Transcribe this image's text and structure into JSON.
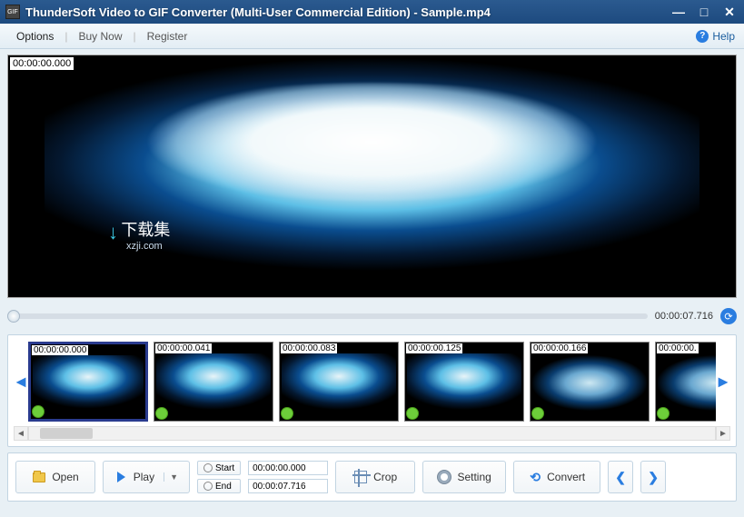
{
  "titlebar": {
    "app_icon_label": "GIF",
    "title": "ThunderSoft Video to GIF Converter (Multi-User Commercial Edition) - Sample.mp4"
  },
  "menubar": {
    "options": "Options",
    "buy_now": "Buy Now",
    "register": "Register",
    "help": "Help"
  },
  "preview": {
    "timestamp": "00:00:00.000",
    "watermark_cn": "下载集",
    "watermark_url": "xzji.com"
  },
  "timeline": {
    "total_time": "00:00:07.716"
  },
  "thumbs": [
    {
      "time": "00:00:00.000",
      "selected": true,
      "variant": "1"
    },
    {
      "time": "00:00:00.041",
      "selected": false,
      "variant": "1"
    },
    {
      "time": "00:00:00.083",
      "selected": false,
      "variant": "1"
    },
    {
      "time": "00:00:00.125",
      "selected": false,
      "variant": "1"
    },
    {
      "time": "00:00:00.166",
      "selected": false,
      "variant": "2"
    },
    {
      "time": "00:00:00.",
      "selected": false,
      "variant": "2"
    }
  ],
  "actions": {
    "open": "Open",
    "play": "Play",
    "start": "Start",
    "end": "End",
    "start_time": "00:00:00.000",
    "end_time": "00:00:07.716",
    "crop": "Crop",
    "setting": "Setting",
    "convert": "Convert"
  }
}
